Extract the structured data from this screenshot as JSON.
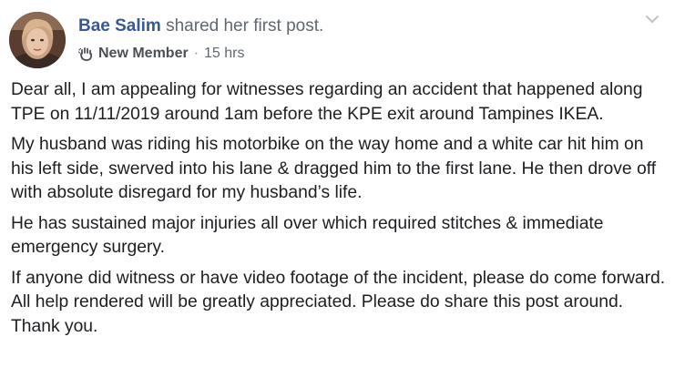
{
  "post": {
    "author": {
      "name": "Bae Salim",
      "action": "shared her first post."
    },
    "meta": {
      "badge_icon": "wave-hand-icon",
      "badge_label": "New Member",
      "separator": "·",
      "timestamp": "15 hrs"
    },
    "options_icon": "chevron-down-icon",
    "paragraphs": [
      "Dear all, I am appealing for witnesses regarding an accident that happened along TPE on 11/11/2019 around 1am before the KPE exit around Tampines IKEA.",
      "My husband was riding his motorbike on the way home and a white car hit him on his left side, swerved into his lane & dragged him to the first lane. He then drove off with absolute disregard for my husband’s life.",
      "He has sustained major injuries all over which required stitches & immediate emergency surgery.",
      "If anyone did witness or have video footage of the incident, please do come forward. All help rendered will be greatly appreciated. Please do share this post around. Thank you."
    ]
  },
  "colors": {
    "author_link": "#385898",
    "secondary_text": "#606770",
    "body_text": "#1c1e21"
  }
}
